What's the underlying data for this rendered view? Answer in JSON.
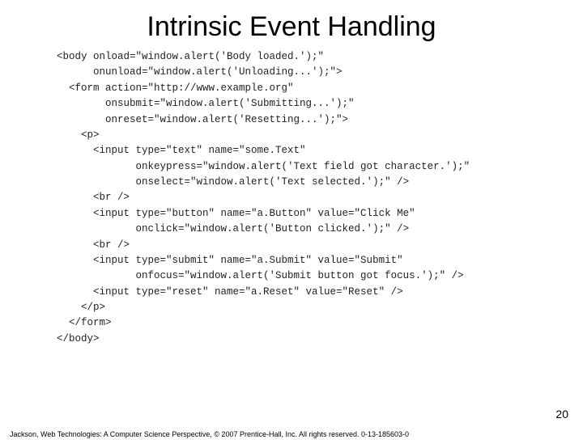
{
  "title": "Intrinsic Event Handling",
  "code": "<body onload=\"window.alert('Body loaded.');\"\n      onunload=\"window.alert('Unloading...');\">\n  <form action=\"http://www.example.org\"\n        onsubmit=\"window.alert('Submitting...');\"\n        onreset=\"window.alert('Resetting...');\">\n    <p>\n      <input type=\"text\" name=\"some.Text\"\n             onkeypress=\"window.alert('Text field got character.');\"\n             onselect=\"window.alert('Text selected.');\" />\n      <br />\n      <input type=\"button\" name=\"a.Button\" value=\"Click Me\"\n             onclick=\"window.alert('Button clicked.');\" />\n      <br />\n      <input type=\"submit\" name=\"a.Submit\" value=\"Submit\"\n             onfocus=\"window.alert('Submit button got focus.');\" />\n      <input type=\"reset\" name=\"a.Reset\" value=\"Reset\" />\n    </p>\n  </form>\n</body>",
  "page_number": "20",
  "footer": "Jackson, Web Technologies: A Computer Science Perspective, © 2007 Prentice-Hall, Inc. All rights reserved. 0-13-185603-0"
}
